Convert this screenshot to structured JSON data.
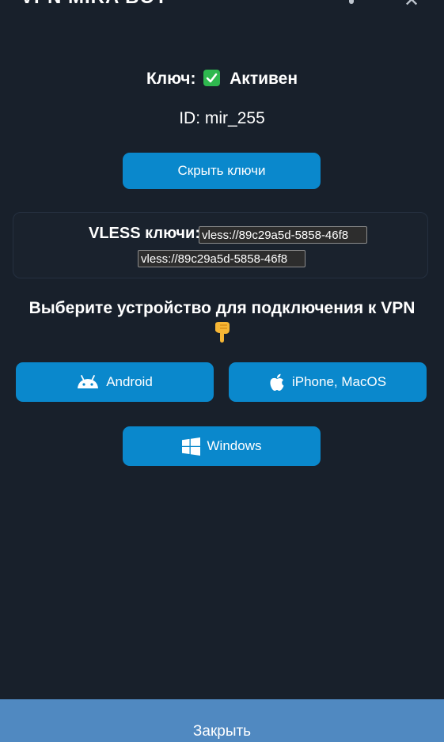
{
  "header": {
    "title": "VPN MIRA BOT"
  },
  "status": {
    "label": "Ключ:",
    "value": "Активен"
  },
  "account": {
    "id_text": "ID: mir_255"
  },
  "buttons": {
    "hide_keys": "Скрыть ключи",
    "android": "Android",
    "iphone_macos": "iPhone, MacOS",
    "windows": "Windows",
    "close": "Закрыть"
  },
  "keys": {
    "label": "VLESS ключи:",
    "values": [
      "vless://89c29a5d-5858-46f8",
      "vless://89c29a5d-5858-46f8"
    ]
  },
  "device_prompt": {
    "text": "Выберите устройство для подключения к VPN"
  },
  "colors": {
    "background": "#18202b",
    "button": "#0a88cc",
    "close_bar": "#5089c1",
    "check": "#2fb84f"
  },
  "icons": {
    "status": "check-icon",
    "prompt": "pointing-down-hand-icon",
    "android": "android-icon",
    "apple": "apple-icon",
    "windows": "windows-icon"
  }
}
